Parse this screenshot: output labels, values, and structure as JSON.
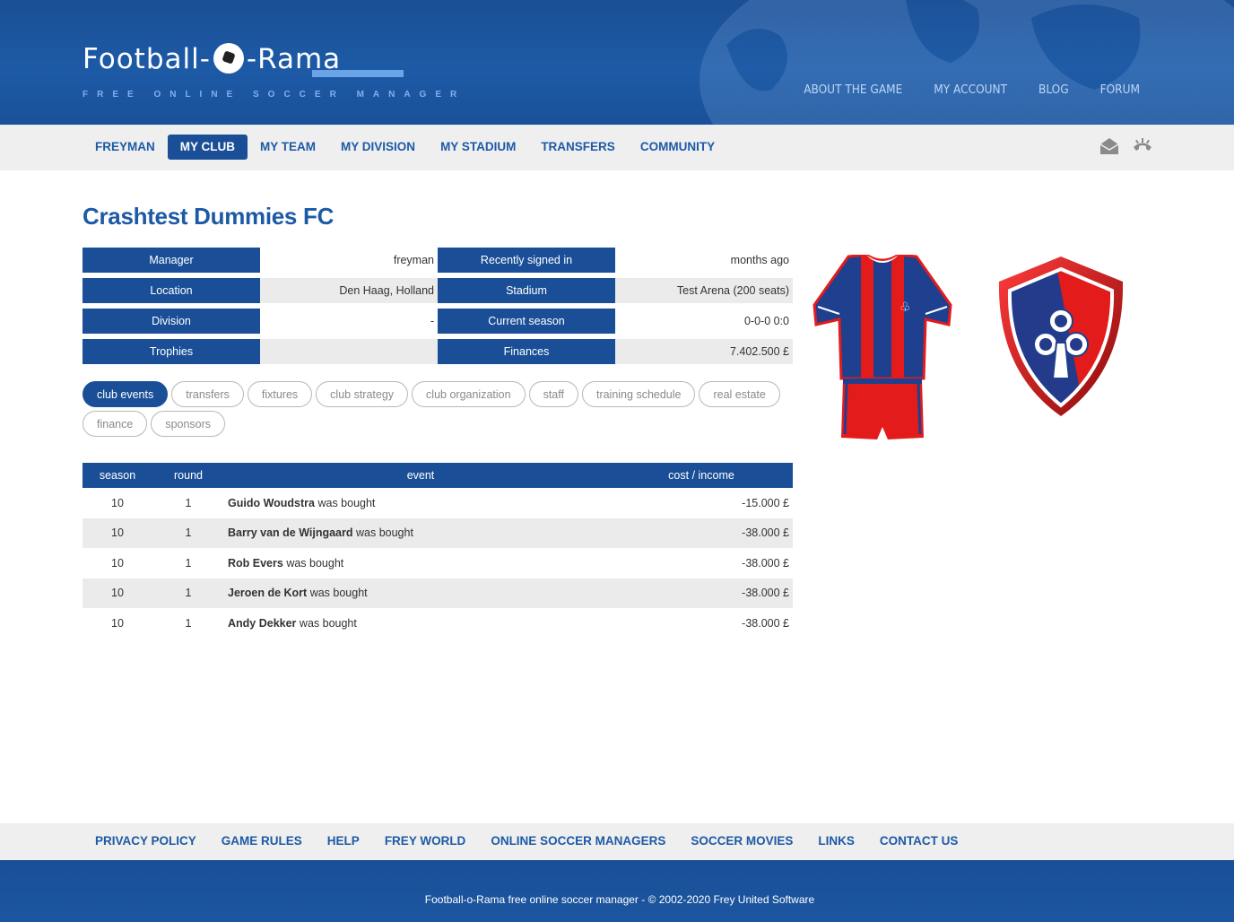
{
  "header": {
    "logo_text_left": "Football-",
    "logo_text_right": "-Rama",
    "logo_tagline": "FREE ONLINE SOCCER MANAGER",
    "top_links": [
      "ABOUT THE GAME",
      "MY ACCOUNT",
      "BLOG",
      "FORUM"
    ]
  },
  "main_nav": {
    "items": [
      "FREYMAN",
      "MY CLUB",
      "MY TEAM",
      "MY DIVISION",
      "MY STADIUM",
      "TRANSFERS",
      "COMMUNITY"
    ],
    "active": "MY CLUB",
    "icons": [
      "mail-icon",
      "phone-icon"
    ]
  },
  "club": {
    "name": "Crashtest Dummies FC",
    "info": [
      {
        "label_left": "Manager",
        "value_left": "freyman",
        "label_right": "Recently signed in",
        "value_right": "months ago"
      },
      {
        "label_left": "Location",
        "value_left": "Den Haag, Holland",
        "label_right": "Stadium",
        "value_right": "Test Arena (200 seats)"
      },
      {
        "label_left": "Division",
        "value_left": "-",
        "label_right": "Current season",
        "value_right": "0-0-0 0:0"
      },
      {
        "label_left": "Trophies",
        "value_left": "",
        "label_right": "Finances",
        "value_right": "7.402.500 £"
      }
    ],
    "colors": {
      "shirt_primary": "#1f3f8f",
      "shirt_secondary": "#e41b1b",
      "crest_primary": "#1f3f8f",
      "crest_secondary": "#e41b1b"
    }
  },
  "tabs": {
    "items": [
      "club events",
      "transfers",
      "fixtures",
      "club strategy",
      "club organization",
      "staff",
      "training schedule",
      "real estate",
      "finance",
      "sponsors"
    ],
    "active": "club events"
  },
  "events_table": {
    "headers": [
      "season",
      "round",
      "event",
      "cost / income"
    ],
    "rows": [
      {
        "season": "10",
        "round": "1",
        "player": "Guido Woudstra",
        "action": " was bought",
        "amount": "-15.000 £"
      },
      {
        "season": "10",
        "round": "1",
        "player": "Barry van de Wijngaard",
        "action": " was bought",
        "amount": "-38.000 £"
      },
      {
        "season": "10",
        "round": "1",
        "player": "Rob Evers",
        "action": " was bought",
        "amount": "-38.000 £"
      },
      {
        "season": "10",
        "round": "1",
        "player": "Jeroen de Kort",
        "action": " was bought",
        "amount": "-38.000 £"
      },
      {
        "season": "10",
        "round": "1",
        "player": "Andy Dekker",
        "action": " was bought",
        "amount": "-38.000 £"
      }
    ]
  },
  "footer": {
    "links": [
      "PRIVACY POLICY",
      "GAME RULES",
      "HELP",
      "FREY WORLD",
      "ONLINE SOCCER MANAGERS",
      "SOCCER MOVIES",
      "LINKS",
      "CONTACT US"
    ],
    "copyright": "Football-o-Rama free online soccer manager - © 2002-2020 Frey United Software"
  }
}
